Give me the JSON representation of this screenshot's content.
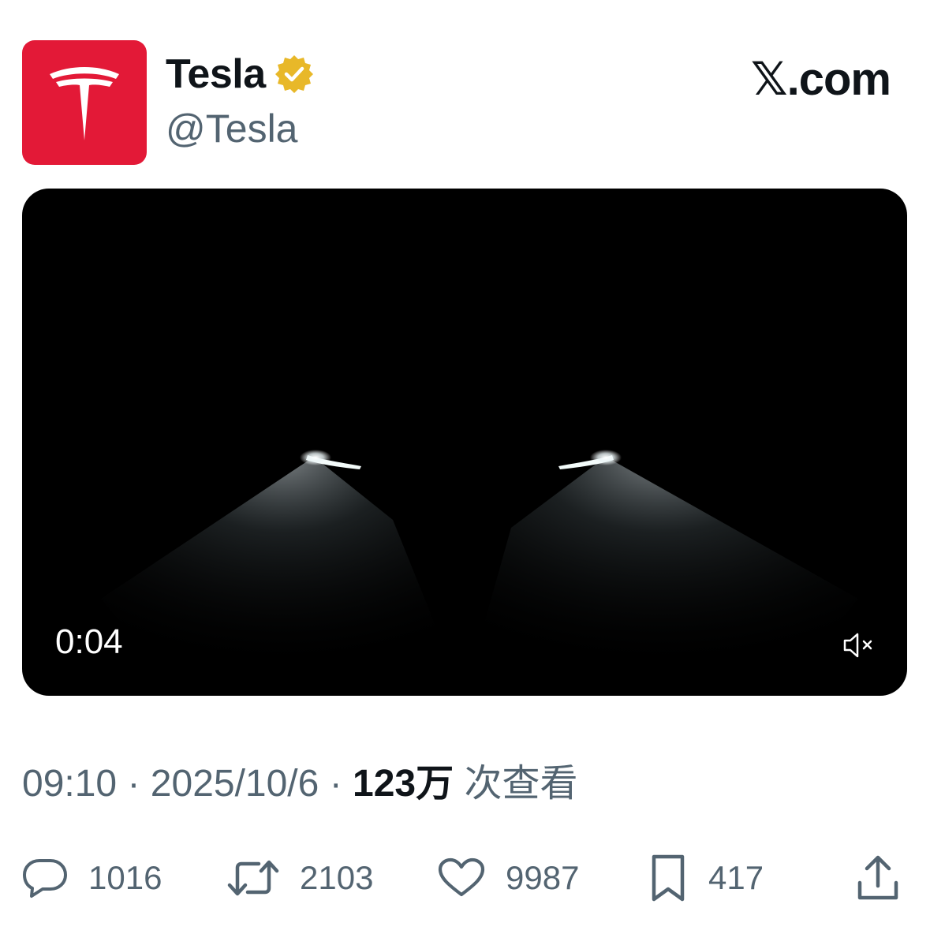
{
  "tweet": {
    "display_name": "Tesla",
    "handle": "@Tesla",
    "source_label": "𝕏.com",
    "verified": true,
    "video": {
      "time": "0:04",
      "muted": true
    },
    "meta": {
      "time": "09:10",
      "separator": "·",
      "date": "2025/10/6",
      "views": "123万",
      "views_label": "次查看"
    },
    "actions": {
      "replies": "1016",
      "retweets": "2103",
      "likes": "9987",
      "bookmarks": "417"
    }
  },
  "colors": {
    "brand_red": "#e31937",
    "verified_gold": "#e8b829",
    "text_primary": "#0f1419",
    "text_secondary": "#536471"
  }
}
